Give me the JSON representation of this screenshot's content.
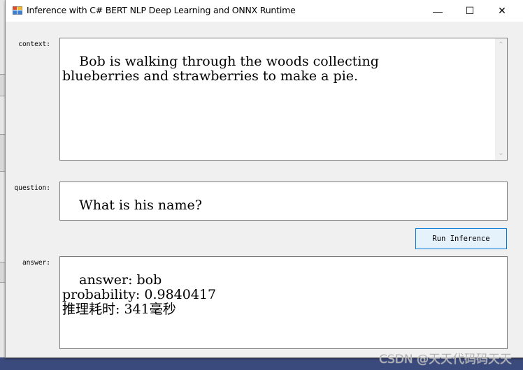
{
  "window": {
    "title": "Inference with C# BERT NLP Deep Learning and ONNX Runtime",
    "controls": {
      "minimize": "—",
      "maximize": "☐",
      "close": "✕"
    }
  },
  "form": {
    "context": {
      "label": "context:",
      "value": "Bob is walking through the woods collecting\nblueberries and strawberries to make a pie."
    },
    "question": {
      "label": "question:",
      "value": "What is his name?"
    },
    "run_button": "Run Inference",
    "answer": {
      "label": "answer:",
      "value": "answer: bob\nprobability: 0.9840417\n推理耗时: 341毫秒"
    }
  },
  "icons": {
    "scroll_up": "⌃",
    "scroll_down": "⌄"
  },
  "watermark": "CSDN @天天代码码天天"
}
